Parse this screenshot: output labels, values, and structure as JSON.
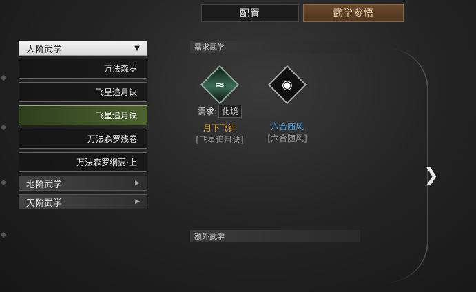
{
  "tabs": [
    {
      "label": "配置",
      "active": false
    },
    {
      "label": "武学参悟",
      "active": true
    }
  ],
  "left": {
    "dropdown_label": "人阶武学",
    "items": [
      {
        "label": "万法森罗",
        "selected": false
      },
      {
        "label": "飞星追月诀",
        "selected": false
      },
      {
        "label": "飞星追月诀",
        "selected": true
      },
      {
        "label": "万法森罗残卷",
        "selected": false
      },
      {
        "label": "万法森罗纲要·上",
        "selected": false
      }
    ],
    "categories": [
      {
        "label": "地阶武学"
      },
      {
        "label": "天阶武学"
      }
    ]
  },
  "sections": {
    "required": "需求武学",
    "extra": "额外武学"
  },
  "skills": [
    {
      "req_label": "需求:",
      "req_value": "化境",
      "name": "月下飞针",
      "source": "[飞星追月诀]",
      "name_color": "#f0b446",
      "icon": "jade-scroll-icon"
    },
    {
      "req_label": "",
      "req_value": "",
      "name": "六合随风",
      "source": "[六合随风]",
      "name_color": "#56a9ec",
      "icon": "sitting-figure-icon"
    }
  ]
}
